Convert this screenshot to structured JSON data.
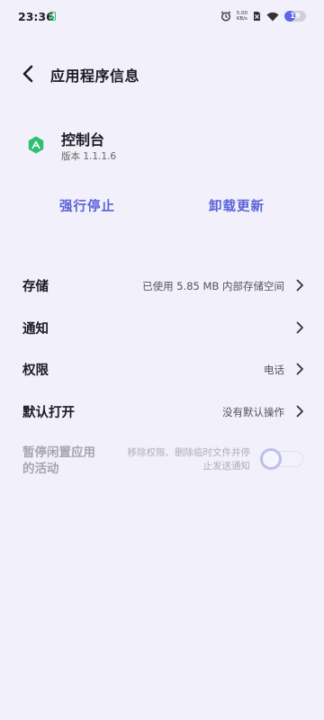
{
  "status_bar": {
    "time": "23:36",
    "speed_value": "5.00",
    "speed_unit": "KB/s",
    "battery_level": "19",
    "battery_fraction": 0.5
  },
  "header": {
    "title": "应用程序信息",
    "back_icon": "chevron-left-icon"
  },
  "app": {
    "name": "控制台",
    "version": "版本 1.1.1.6",
    "icon_color": "#2fbf71"
  },
  "actions": {
    "force_stop": "强行停止",
    "uninstall_updates": "卸载更新"
  },
  "settings": [
    {
      "title": "存储",
      "value": "已使用 5.85 MB 内部存储空间"
    },
    {
      "title": "通知",
      "value": ""
    },
    {
      "title": "权限",
      "value": "电话"
    },
    {
      "title": "默认打开",
      "value": "没有默认操作"
    }
  ],
  "pause_activity": {
    "title": "暂停闲置应用的活动",
    "summary": "移除权限、删除临时文件并停止发送通知",
    "enabled": false
  },
  "colors": {
    "accent": "#5b63d9",
    "background": "#f1f0fb"
  }
}
